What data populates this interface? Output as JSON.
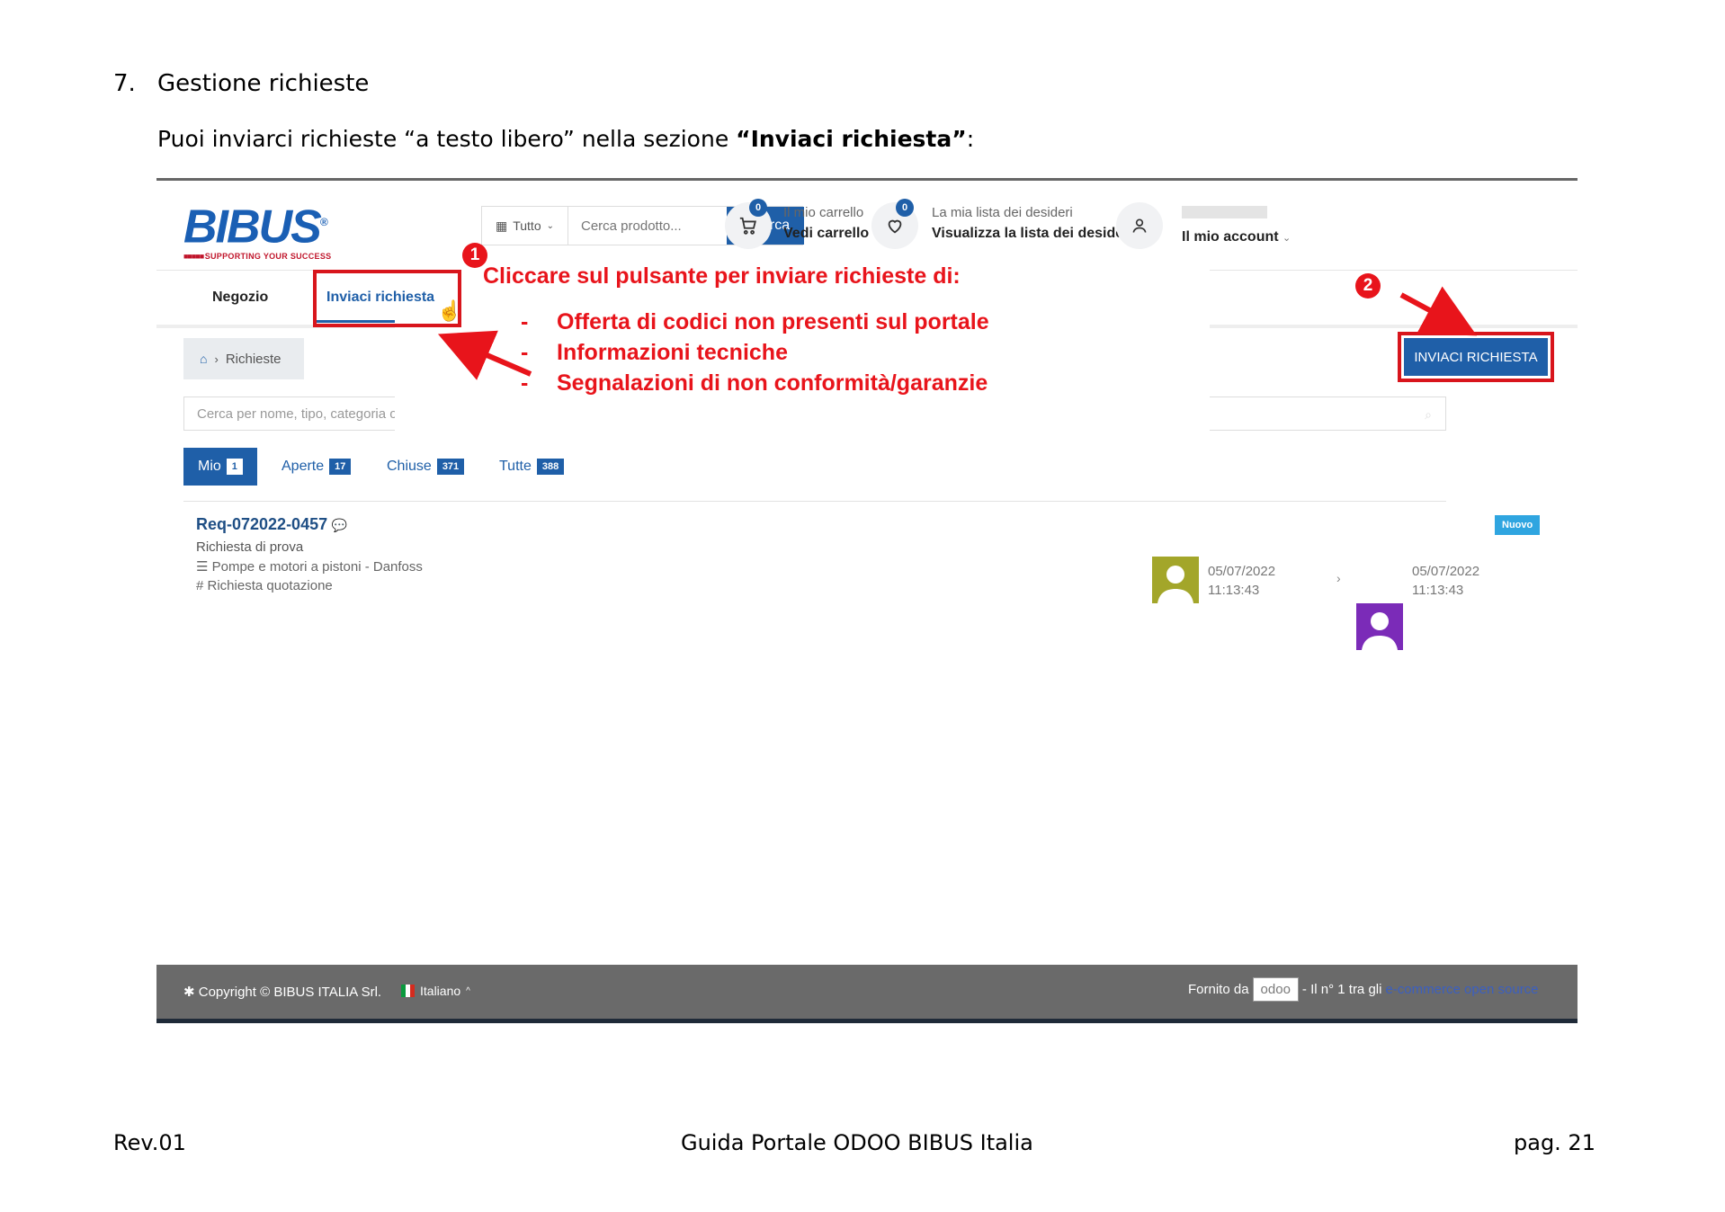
{
  "section": {
    "number": "7.",
    "title": "Gestione richieste"
  },
  "intro": {
    "before": "Puoi inviarci richieste “a testo libero” nella sezione ",
    "bold": "“Inviaci richiesta”",
    "after": ":"
  },
  "screenshot": {
    "logo": {
      "word": "BIBUS",
      "reg": "®",
      "tagline": "SUPPORTING YOUR SUCCESS"
    },
    "search": {
      "category": "Tutto",
      "placeholder": "Cerca prodotto...",
      "button": "Ricerca"
    },
    "cart": {
      "count": "0",
      "top": "Il mio carrello",
      "bottom": "Vedi carrello"
    },
    "wishlist": {
      "count": "0",
      "top": "La mia lista dei desideri",
      "bottom": "Visualizza la lista dei desideri"
    },
    "account": {
      "bottom": "Il mio account"
    },
    "nav": {
      "shop": "Negozio",
      "send_request": "Inviaci richiesta"
    },
    "breadcrumb": {
      "label": "Richieste"
    },
    "action_button": "INVIACI RICHIESTA",
    "filter": {
      "placeholder": "Cerca per nome, tipo, categoria o messaggio"
    },
    "tabs": [
      {
        "label": "Mio",
        "count": "1"
      },
      {
        "label": "Aperte",
        "count": "17"
      },
      {
        "label": "Chiuse",
        "count": "371"
      },
      {
        "label": "Tutte",
        "count": "388"
      }
    ],
    "request": {
      "id": "Req-072022-0457",
      "subtitle": "Richiesta di prova",
      "category": "Pompe e motori a pistoni - Danfoss",
      "tag": "Richiesta quotazione",
      "status": "Nuovo",
      "created": {
        "date": "05/07/2022",
        "time": "11:13:43"
      },
      "updated": {
        "date": "05/07/2022",
        "time": "11:13:43"
      }
    },
    "footer": {
      "copyright": "Copyright © BIBUS ITALIA Srl.",
      "language": "Italiano",
      "powered": "Fornito da",
      "odoo": "odoo",
      "tail": "- Il n° 1 tra gli",
      "link": "e-commerce open source"
    }
  },
  "annotations": {
    "marker1": "1",
    "marker2": "2",
    "heading": "Cliccare sul pulsante per inviare richieste di:",
    "items": [
      "Offerta di codici non presenti sul portale",
      "Informazioni tecniche",
      "Segnalazioni di non conformità/garanzie"
    ],
    "dash": "-"
  },
  "page_footer": {
    "left": "Rev.01",
    "center": "Guida Portale ODOO BIBUS Italia",
    "right": "pag. 21"
  },
  "colors": {
    "brand_blue": "#1f5fa8",
    "annotation_red": "#e8141b",
    "badge_new": "#2fa5e0"
  }
}
